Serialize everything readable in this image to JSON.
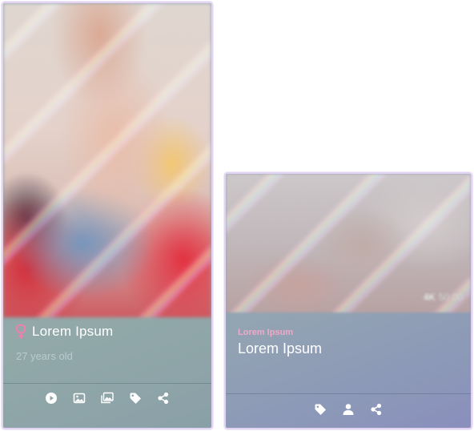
{
  "colors": {
    "card_border": "#e2d3f3",
    "accent_pink": "#f0a8c8",
    "icon_color": "#ffffff"
  },
  "model_card": {
    "name": "Lorem Ipsum",
    "age": "27 years old",
    "gender_icon": "female-icon",
    "actions": [
      "play-icon",
      "image-icon",
      "gallery-icon",
      "tag-icon",
      "share-icon"
    ]
  },
  "video_card": {
    "subtitle": "Lorem Ipsum",
    "title": "Lorem Ipsum",
    "quality": "4K",
    "duration": "50:00",
    "actions": [
      "tag-icon",
      "user-icon",
      "share-icon"
    ]
  }
}
